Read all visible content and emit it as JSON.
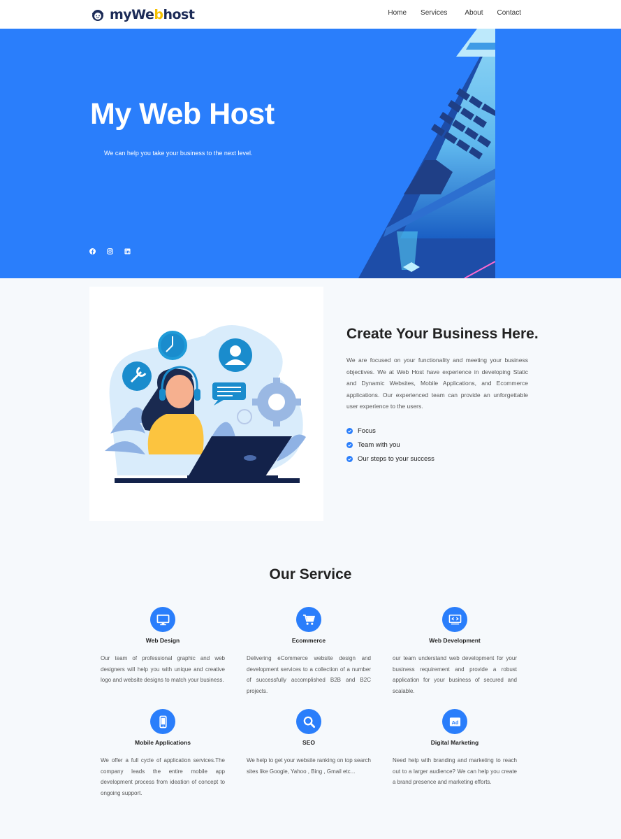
{
  "header": {
    "logo": {
      "text_a": "myWe",
      "text_b": "b",
      "text_c": "host"
    },
    "nav": [
      "Home",
      "Services",
      "About",
      "Contact"
    ]
  },
  "hero": {
    "title": "My Web Host",
    "subtitle": "We can help you take your business to the next level.",
    "social_icons": [
      "facebook-icon",
      "instagram-icon",
      "linkedin-icon"
    ]
  },
  "about": {
    "title": "Create Your Business Here.",
    "text": "We are focused on your functionality and meeting your business objectives. We at Web Host have experience in developing Static and Dynamic Websites, Mobile Applications, and Ecommerce applications. Our experienced team can provide an unforgettable user experience to the users.",
    "items": [
      "Focus",
      "Team with you",
      "Our steps to your success"
    ]
  },
  "services": {
    "title": "Our Service",
    "items": [
      {
        "name": "Web Design",
        "icon": "monitor-icon",
        "desc": "Our team of professional graphic and web designers will help you with unique and creative logo and website designs to match your business."
      },
      {
        "name": "Ecommerce",
        "icon": "cart-icon",
        "desc": "Delivering eCommerce website design and development services to a collection of a number of successfully accomplished B2B and B2C projects."
      },
      {
        "name": "Web Development",
        "icon": "code-icon",
        "desc": "our team understand web development for your business requirement and provide a robust application for your business of secured and scalable."
      },
      {
        "name": "Mobile Applications",
        "icon": "mobile-icon",
        "desc": "We offer a full cycle of application services.The company leads the entire mobile app development process from ideation of concept to ongoing support."
      },
      {
        "name": "SEO",
        "icon": "search-icon",
        "desc": "We help to get your website ranking on top search sites like Google, Yahoo , Bing , Gmail etc..."
      },
      {
        "name": "Digital Marketing",
        "icon": "ad-icon",
        "desc": "Need help with branding and marketing to reach out to a larger audience? We can help you create a brand presence and marketing efforts."
      }
    ]
  },
  "colors": {
    "primary": "#2a7efb",
    "navy": "#1c2b57",
    "accent": "#f5c100"
  }
}
